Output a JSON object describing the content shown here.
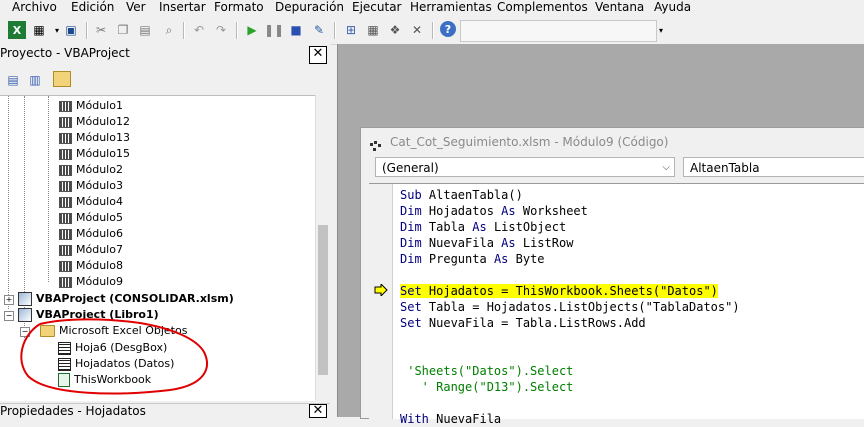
{
  "menu": [
    "Archivo",
    "Edición",
    "Ver",
    "Insertar",
    "Formato",
    "Depuración",
    "Ejecutar",
    "Herramientas",
    "Complementos",
    "Ventana",
    "Ayuda"
  ],
  "project_pane": {
    "title": "Proyecto - VBAProject",
    "tree": {
      "modules": [
        "Módulo1",
        "Módulo12",
        "Módulo13",
        "Módulo15",
        "Módulo2",
        "Módulo3",
        "Módulo4",
        "Módulo5",
        "Módulo6",
        "Módulo7",
        "Módulo8",
        "Módulo9"
      ],
      "project_consolidar": "VBAProject (CONSOLIDAR.xlsm)",
      "project_libro1": "VBAProject (Libro1)",
      "folder_objects": "Microsoft Excel Objetos",
      "objects": [
        "Hoja6 (DesgBox)",
        "Hojadatos (Datos)",
        "ThisWorkbook"
      ]
    }
  },
  "properties_pane": {
    "title": "Propiedades - Hojadatos"
  },
  "code_window": {
    "title": "Cat_Cot_Seguimiento.xlsm - Módulo9 (Código)",
    "object_combo": "(General)",
    "procedure_combo": "AltaenTabla",
    "lines": [
      "Sub AltaenTabla()",
      "Dim Hojadatos As Worksheet",
      "Dim Tabla As ListObject",
      "Dim NuevaFila As ListRow",
      "Dim Pregunta As Byte",
      "",
      "Set Hojadatos = ThisWorkbook.Sheets(\"Datos\")",
      "Set Tabla = Hojadatos.ListObjects(\"TablaDatos\")",
      "Set NuevaFila = Tabla.ListRows.Add",
      "",
      "",
      " 'Sheets(\"Datos\").Select",
      "   ' Range(\"D13\").Select",
      "",
      "With NuevaFila"
    ],
    "highlighted_line_index": 6
  },
  "colors": {
    "highlight": "#ffff00",
    "keyword": "#00007f",
    "comment": "#007f00",
    "annotation": "#e00000"
  }
}
